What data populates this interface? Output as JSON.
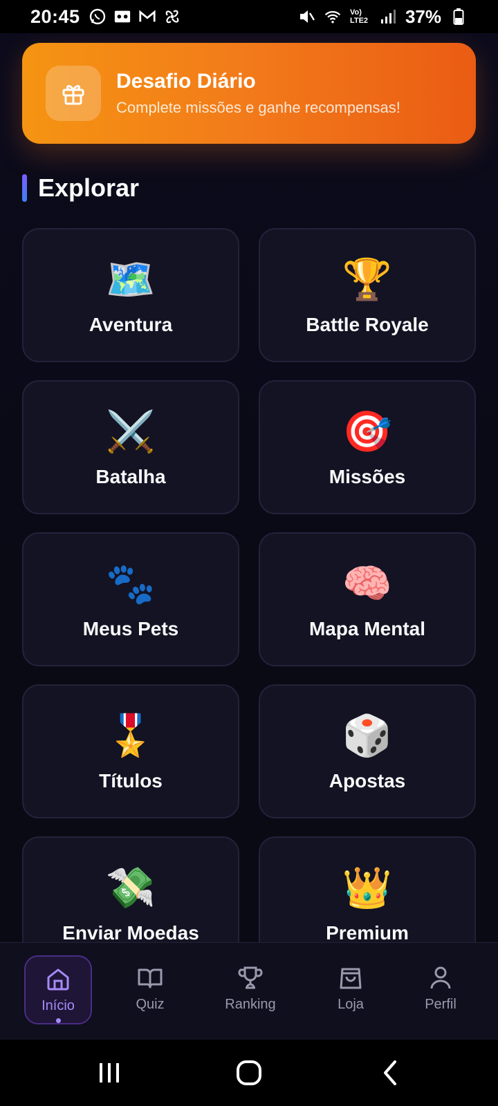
{
  "status_bar": {
    "time": "20:45",
    "battery": "37%",
    "network_label": "Vo) LTE2",
    "left_icons": [
      "whatsapp-icon",
      "voicemail-icon",
      "gmail-icon",
      "fan-icon"
    ],
    "right_icons": [
      "mute-icon",
      "wifi-icon",
      "signal-icon",
      "battery-icon"
    ]
  },
  "daily_challenge": {
    "title": "Desafio Diário",
    "subtitle": "Complete missões e ganhe recompensas!",
    "icon": "gift-icon"
  },
  "explore": {
    "title": "Explorar",
    "tiles": [
      {
        "emoji": "🗺️",
        "label": "Aventura",
        "icon": "map-icon"
      },
      {
        "emoji": "🏆",
        "label": "Battle Royale",
        "icon": "trophy-icon"
      },
      {
        "emoji": "⚔️",
        "label": "Batalha",
        "icon": "crossed-swords-icon"
      },
      {
        "emoji": "🎯",
        "label": "Missões",
        "icon": "target-icon"
      },
      {
        "emoji": "🐾",
        "label": "Meus Pets",
        "icon": "paw-icon"
      },
      {
        "emoji": "🧠",
        "label": "Mapa Mental",
        "icon": "brain-icon"
      },
      {
        "emoji": "🎖️",
        "label": "Títulos",
        "icon": "medal-icon"
      },
      {
        "emoji": "🎲",
        "label": "Apostas",
        "icon": "dice-icon"
      },
      {
        "emoji": "💸",
        "label": "Enviar Moedas",
        "icon": "money-wings-icon"
      },
      {
        "emoji": "👑",
        "label": "Premium",
        "icon": "crown-icon"
      }
    ]
  },
  "bottom_nav": {
    "items": [
      {
        "label": "Início",
        "icon": "home-icon",
        "active": true
      },
      {
        "label": "Quiz",
        "icon": "book-icon",
        "active": false
      },
      {
        "label": "Ranking",
        "icon": "trophy-icon",
        "active": false
      },
      {
        "label": "Loja",
        "icon": "shopping-bag-icon",
        "active": false
      },
      {
        "label": "Perfil",
        "icon": "user-icon",
        "active": false
      }
    ]
  },
  "colors": {
    "background": "#0b0b16",
    "accent": "#a78bfa",
    "daily_gradient_start": "#f59412",
    "daily_gradient_end": "#ea5c13",
    "tile_background": "#131324"
  }
}
